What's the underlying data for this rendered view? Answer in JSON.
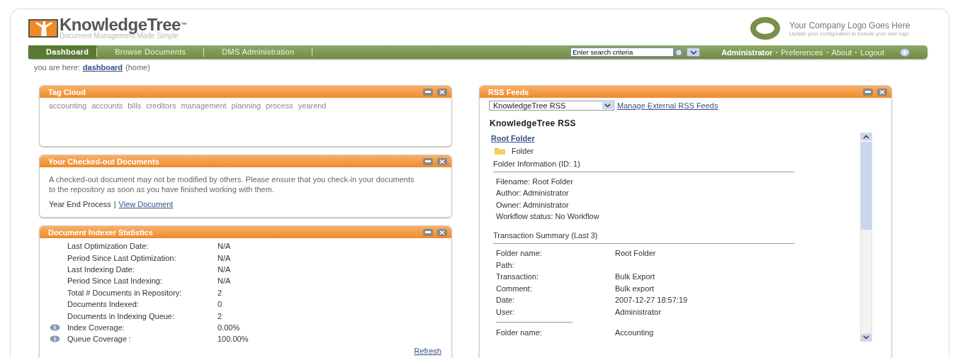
{
  "header": {
    "logo_title": "KnowledgeTree",
    "logo_mark": "™",
    "logo_subtitle": "Document Management Made Simple",
    "company_title": "Your Company Logo Goes Here",
    "company_subtitle": "Update your configuration to include your own logo."
  },
  "nav": {
    "tabs": [
      {
        "label": "Dashboard",
        "selected": true
      },
      {
        "label": "Browse Documents",
        "selected": false
      },
      {
        "label": "DMS Administration",
        "selected": false
      }
    ],
    "search": {
      "value": "Enter search criteria"
    },
    "user": "Administrator",
    "links": [
      "Preferences",
      "About",
      "Logout"
    ]
  },
  "breadcrumb": {
    "prefix": "you are here:",
    "link": "dashboard",
    "suffix": "(home)"
  },
  "tag_cloud": {
    "title": "Tag Cloud",
    "tags": [
      "accounting",
      "accounts",
      "bills",
      "creditors",
      "management",
      "planning",
      "process",
      "yearend"
    ]
  },
  "checked_out": {
    "title": "Your Checked-out Documents",
    "text": "A checked-out document may not be modified by others. Please ensure that you check-in your documents to the repository as soon as you have finished working with them.",
    "document": "Year End Process",
    "separator": "|",
    "link": "View Document"
  },
  "indexer": {
    "title": "Document Indexer Statistics",
    "rows": [
      {
        "label": "Last Optimization Date:",
        "value": "N/A",
        "info": false
      },
      {
        "label": "Period Since Last Optimization:",
        "value": "N/A",
        "info": false
      },
      {
        "label": "Last Indexing Date:",
        "value": "N/A",
        "info": false
      },
      {
        "label": "Period Since Last Indexing:",
        "value": "N/A",
        "info": false
      },
      {
        "label": "Total # Documents in Repository:",
        "value": "2",
        "info": false
      },
      {
        "label": "Documents Indexed:",
        "value": "0",
        "info": false
      },
      {
        "label": "Documents in Indexing Queue:",
        "value": "2",
        "info": false
      },
      {
        "label": "Index Coverage:",
        "value": "0.00%",
        "info": true
      },
      {
        "label": "Queue Coverage :",
        "value": "100.00%",
        "info": true
      }
    ],
    "refresh": "Refresh"
  },
  "rss": {
    "title": "RSS Feeds",
    "feed_select": "KnowledgeTree RSS",
    "manage_link": "Manage External RSS Feeds",
    "feed_title": "KnowledgeTree RSS",
    "item": {
      "link": "Root Folder",
      "type": "Folder",
      "info_heading": "Folder Information (ID: 1)",
      "details": [
        "Filename: Root Folder",
        "Author: Administrator",
        "Owner: Administrator",
        "Workflow status: No Workflow"
      ],
      "transactions_heading": "Transaction Summary (Last 3)",
      "transactions": [
        {
          "fields": [
            {
              "label": "Folder name:",
              "value": "Root Folder"
            },
            {
              "label": "Path:"
            },
            {
              "label": "Transaction:",
              "value": "Bulk Export"
            },
            {
              "label": "Comment:",
              "value": "Bulk export"
            },
            {
              "label": "Date:",
              "value": "2007-12-27 18:57:19"
            },
            {
              "label": "User:",
              "value": "Administrator"
            }
          ]
        },
        {
          "fields": [
            {
              "label": "Folder name:",
              "value": "Accounting"
            }
          ]
        }
      ]
    }
  }
}
